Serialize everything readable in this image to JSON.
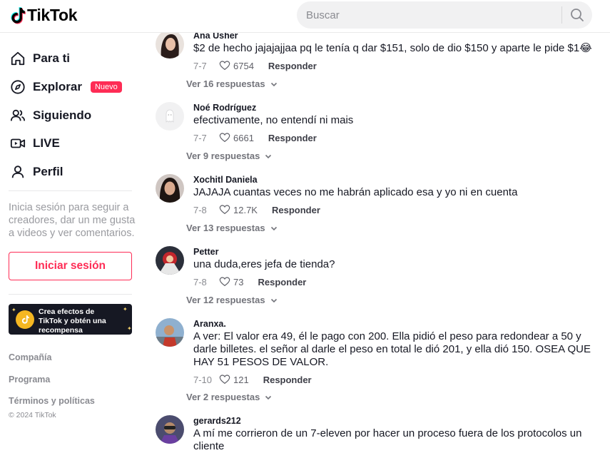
{
  "header": {
    "logo_text": "TikTok",
    "search_placeholder": "Buscar"
  },
  "sidebar": {
    "nav": [
      {
        "label": "Para ti",
        "icon": "home-icon"
      },
      {
        "label": "Explorar",
        "icon": "compass-icon",
        "badge": "Nuevo"
      },
      {
        "label": "Siguiendo",
        "icon": "users-icon"
      },
      {
        "label": "LIVE",
        "icon": "live-icon"
      },
      {
        "label": "Perfil",
        "icon": "user-icon"
      }
    ],
    "login_hint": "Inicia sesión para seguir a creadores, dar un me gusta a videos y ver comentarios.",
    "login_button": "Iniciar sesión",
    "effects_banner": "Crea efectos de TikTok y obtén una recompensa",
    "footer_links": [
      "Compañía",
      "Programa",
      "Términos y políticas"
    ],
    "copyright": "© 2024 TikTok"
  },
  "labels": {
    "reply": "Responder"
  },
  "colors": {
    "accent": "#fe2c55",
    "text": "#161823",
    "muted": "#8a8b91"
  },
  "comments": [
    {
      "user": "Ana Usher",
      "text": "$2 de hecho jajajajjaa pq le tenía q dar $151, solo de dio $150 y aparte le pide $1😂",
      "date": "7-7",
      "likes": "6754",
      "more": "Ver 16 respuestas"
    },
    {
      "user": "Noé Rodríguez",
      "text": "efectivamente, no entendí ni mais",
      "date": "7-7",
      "likes": "6661",
      "more": "Ver 9 respuestas"
    },
    {
      "user": "Xochitl Daniela",
      "text": "JAJAJA cuantas veces no me habrán aplicado esa y yo ni en cuenta",
      "date": "7-8",
      "likes": "12.7K",
      "more": "Ver 13 respuestas"
    },
    {
      "user": "Petter",
      "text": "una duda,eres jefa de tienda?",
      "date": "7-8",
      "likes": "73",
      "more": "Ver 12 respuestas"
    },
    {
      "user": "Aranxa.",
      "text": "A ver: El valor era 49, él le pago con 200. Ella pidió el peso para redondear a 50 y darle billetes. el señor al darle el peso en total le dió 201, y ella dió 150. OSEA QUE HAY 51 PESOS DE VALOR.",
      "date": "7-10",
      "likes": "121",
      "more": "Ver 2 respuestas"
    },
    {
      "user": "gerards212",
      "text": "A mí me corrieron de un 7-eleven por hacer un proceso fuera de los protocolos un cliente",
      "date": "",
      "likes": "",
      "more": ""
    }
  ]
}
